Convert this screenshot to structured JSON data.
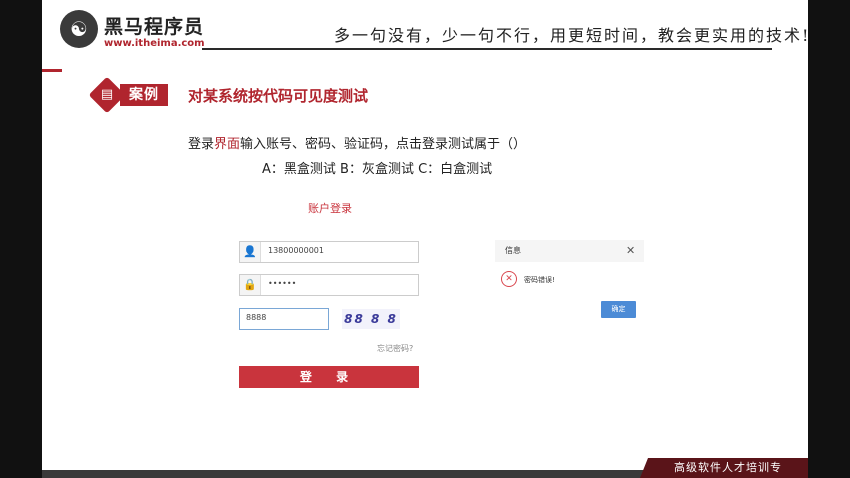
{
  "header": {
    "logo_glyph": "☯",
    "logo_cn": "黑马程序员",
    "logo_url": "www.itheima.com",
    "slogan": "多一句没有，少一句不行，用更短时间，教会更实用的技术!"
  },
  "case": {
    "icon_glyph": "▤",
    "badge": "案例",
    "title": "对某系统按代码可见度测试"
  },
  "question": {
    "prefix": "登录",
    "highlight": "界面",
    "suffix": "输入账号、密码、验证码，点击登录测试属于（）",
    "options": "A：黑盒测试  B：灰盒测试  C：白盒测试"
  },
  "login": {
    "title": "账户登录",
    "username_icon": "👤",
    "username_value": "13800000001",
    "password_icon": "🔒",
    "password_value": "••••••",
    "captcha_value": "8888",
    "captcha_image_text": "88 8 8",
    "forgot": "忘记密码?",
    "submit": "登 录"
  },
  "dialog": {
    "title": "信息",
    "close_glyph": "✕",
    "error_glyph": "✕",
    "message": "密码错误!",
    "ok": "确定"
  },
  "footer": {
    "tag": "高级软件人才培训专"
  }
}
